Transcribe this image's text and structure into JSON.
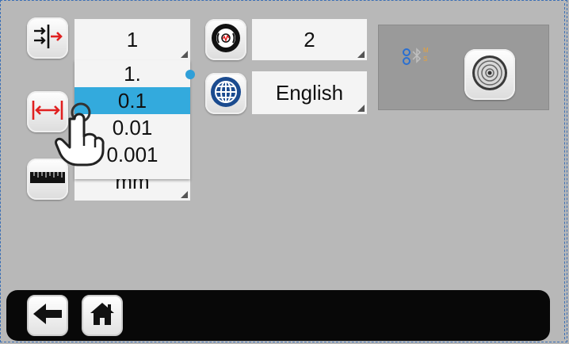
{
  "units_step": {
    "selected_value": "1",
    "options": [
      "1.",
      "0.1",
      "0.01",
      "0.001"
    ],
    "highlighted_option": "0.1"
  },
  "measurement_unit_value": "mm",
  "sensitivity_value": "2",
  "language_value": "English",
  "bluetooth": {
    "label_m": "M",
    "label_s": "S"
  },
  "icons": {
    "step_icon": "arrows-to-line-icon",
    "range_icon": "double-arrow-range-icon",
    "ruler_icon": "ruler-icon",
    "sensitivity_icon": "vibration-icon",
    "language_icon": "globe-icon",
    "scan_icon": "radar-scan-icon",
    "back_icon": "back-arrow-icon",
    "home_icon": "home-icon",
    "hand_icon": "pointing-hand-icon"
  },
  "colors": {
    "highlight": "#33aadd",
    "arrow_red": "#e02020",
    "bt_blue": "#2a6fd1",
    "bt_orange": "#e8a23a"
  }
}
